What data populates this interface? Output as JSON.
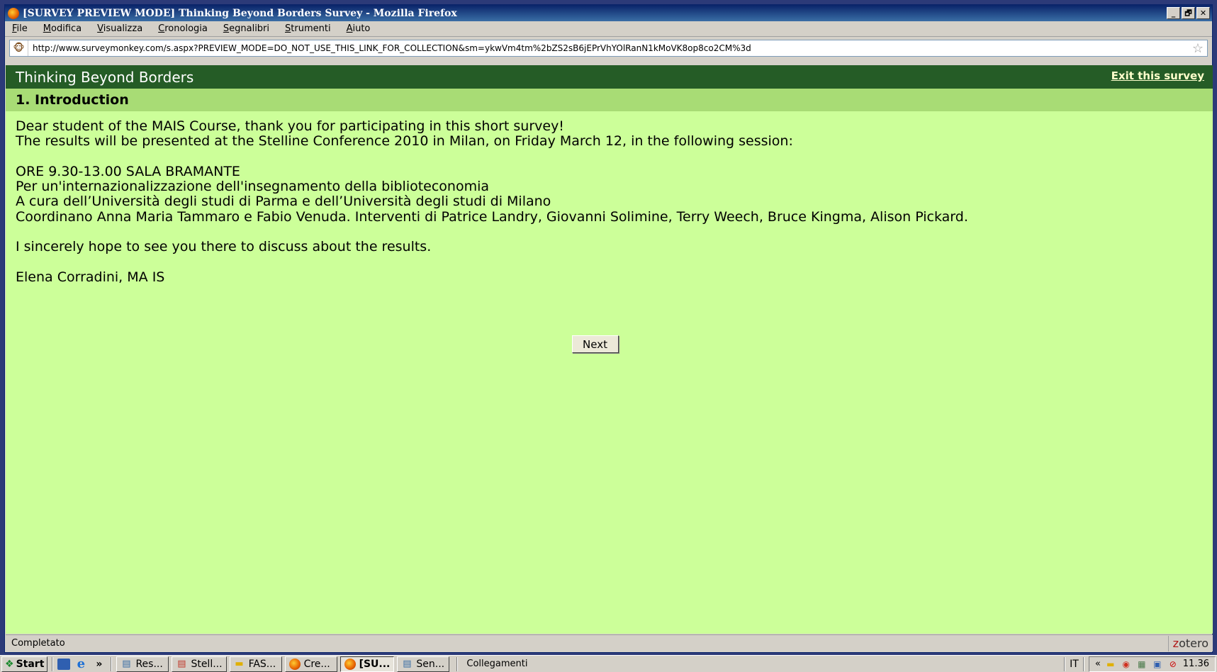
{
  "window": {
    "title": "[SURVEY PREVIEW MODE] Thinking Beyond Borders Survey - Mozilla Firefox",
    "controls": {
      "minimize": "_",
      "restore": "🗗",
      "close": "✕"
    }
  },
  "menu": {
    "items": [
      "File",
      "Modifica",
      "Visualizza",
      "Cronologia",
      "Segnalibri",
      "Strumenti",
      "Aiuto"
    ]
  },
  "address_bar": {
    "url": "http://www.surveymonkey.com/s.aspx?PREVIEW_MODE=DO_NOT_USE_THIS_LINK_FOR_COLLECTION&sm=ykwVm4tm%2bZS2sB6jEPrVhYOlRanN1kMoVK8op8co2CM%3d"
  },
  "survey": {
    "title": "Thinking Beyond Borders",
    "exit_link": "Exit this survey",
    "section_title": "1. Introduction",
    "paragraphs": {
      "p1": "Dear student of the MAIS Course, thank you for participating in this short survey!",
      "p2": "The results will be presented at the Stelline Conference 2010 in Milan, on Friday March 12, in the following session:",
      "p3": "ORE 9.30-13.00 SALA BRAMANTE",
      "p4": "Per un'internazionalizzazione dell'insegnamento della biblioteconomia",
      "p5": "A cura dell’Università degli studi di Parma e dell’Università degli studi di Milano",
      "p6": "Coordinano Anna Maria Tammaro e Fabio Venuda. Interventi di Patrice Landry, Giovanni Solimine, Terry Weech, Bruce Kingma, Alison Pickard.",
      "p7": "I sincerely hope to see you there to discuss about the results.",
      "p8": "Elena Corradini, MA IS"
    },
    "next_button": "Next"
  },
  "status_bar": {
    "text": "Completato",
    "zotero_z": "z",
    "zotero_rest": "otero"
  },
  "taskbar": {
    "start": "Start",
    "chevron": "»",
    "tasks": [
      {
        "label": "Res...",
        "icon": "document-icon"
      },
      {
        "label": "Stell...",
        "icon": "pdf-icon"
      },
      {
        "label": "FAS...",
        "icon": "folder-icon"
      },
      {
        "label": "Cre...",
        "icon": "firefox-icon"
      },
      {
        "label": "[SU...",
        "icon": "firefox-icon",
        "active": true
      },
      {
        "label": "Sen...",
        "icon": "document-icon"
      }
    ],
    "links_label": "Collegamenti",
    "language": "IT",
    "tray_chevron": "«",
    "clock": "11.36"
  }
}
